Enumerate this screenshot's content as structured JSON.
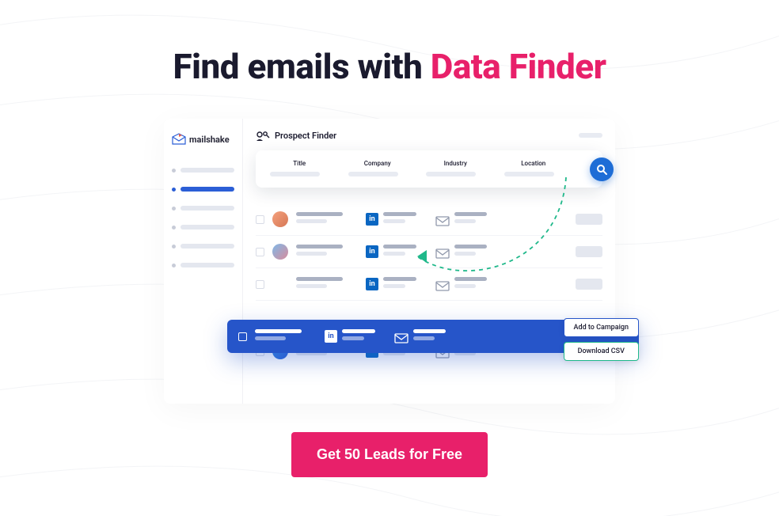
{
  "headline": {
    "prefix": "Find emails with ",
    "accent": "Data Finder"
  },
  "brand": {
    "name": "mailshake"
  },
  "main": {
    "title": "Prospect Finder"
  },
  "search": {
    "fields": [
      "Title",
      "Company",
      "Industry",
      "Location"
    ]
  },
  "popover": {
    "add": "Add to Campaign",
    "download": "Download CSV"
  },
  "cta": "Get 50 Leads for Free",
  "colors": {
    "accent": "#e8206a",
    "primary": "#2655c9"
  }
}
